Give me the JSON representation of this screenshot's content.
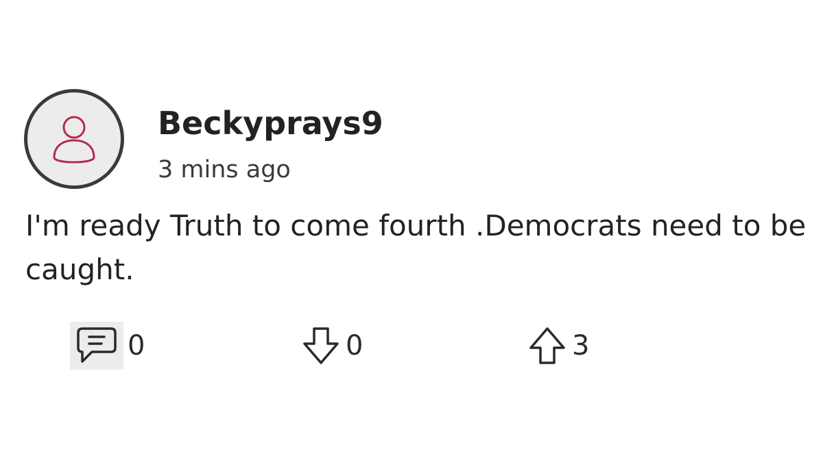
{
  "post": {
    "username": "Beckyprays9",
    "timestamp": "3 mins ago",
    "body": "I'm ready Truth to come fourth .Democrats need to be caught."
  },
  "actions": {
    "comments": {
      "icon": "comment-icon",
      "count": "0"
    },
    "downvotes": {
      "icon": "arrow-down-icon",
      "count": "0"
    },
    "upvotes": {
      "icon": "arrow-up-icon",
      "count": "3"
    }
  },
  "colors": {
    "avatar_icon": "#b32b4c",
    "avatar_bg": "#ececec",
    "avatar_border": "#3a3a3a",
    "text": "#222222"
  }
}
